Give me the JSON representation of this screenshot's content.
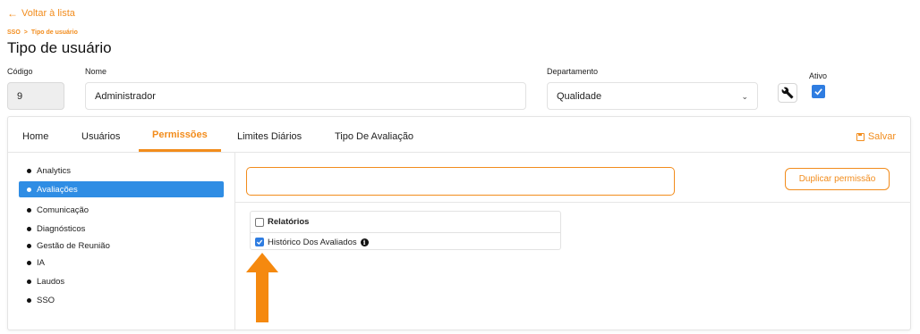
{
  "back_link": {
    "label": "Voltar à lista"
  },
  "breadcrumb": {
    "root": "SSO",
    "separator": ">",
    "current": "Tipo de usuário"
  },
  "page_title": "Tipo de usuário",
  "form": {
    "codigo": {
      "label": "Código",
      "value": "9"
    },
    "nome": {
      "label": "Nome",
      "value": "Administrador"
    },
    "departamento": {
      "label": "Departamento",
      "value": "Qualidade"
    },
    "ativo": {
      "label": "Ativo",
      "checked": true
    }
  },
  "tabs": [
    {
      "label": "Home",
      "active": false
    },
    {
      "label": "Usuários",
      "active": false
    },
    {
      "label": "Permissões",
      "active": true
    },
    {
      "label": "Limites Diários",
      "active": false
    },
    {
      "label": "Tipo De Avaliação",
      "active": false
    }
  ],
  "save_label": "Salvar",
  "sidebar": {
    "items": [
      {
        "label": "Analytics",
        "active": false
      },
      {
        "label": "Avaliações",
        "active": true
      },
      {
        "label": "Comunicação",
        "active": false
      },
      {
        "label": "Diagnósticos",
        "active": false
      },
      {
        "label": "Gestão de Reunião",
        "active": false
      },
      {
        "label": "IA",
        "active": false
      },
      {
        "label": "Laudos",
        "active": false
      },
      {
        "label": "SSO",
        "active": false
      }
    ]
  },
  "permissions": {
    "search_value": "",
    "duplicate_button": "Duplicar permissão",
    "group": {
      "label": "Relatórios",
      "checked": false
    },
    "items": [
      {
        "label": "Histórico Dos Avaliados",
        "checked": true,
        "icon": "info-icon"
      }
    ]
  },
  "colors": {
    "accent": "#f28c1c",
    "selected": "#2f8de4",
    "checkbox": "#2f7de1"
  }
}
